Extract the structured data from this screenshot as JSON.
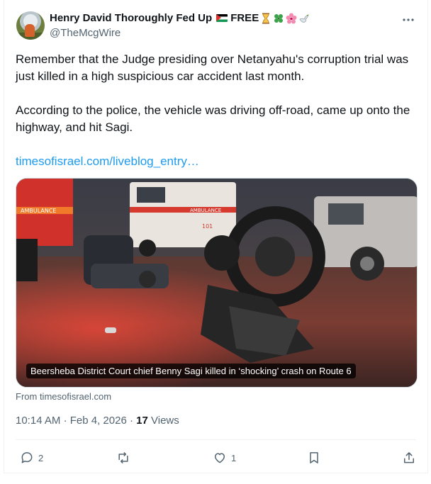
{
  "author": {
    "display_name": "Henry David Thoroughly Fed Up",
    "name_suffix": "FREE",
    "handle": "@TheMcgWire",
    "emoji_after_name": [
      "hourglass",
      "four-leaf-clover",
      "hibiscus",
      "dove"
    ]
  },
  "tweet": {
    "paragraph_1": "Remember that the Judge presiding over Netanyahu's corruption trial was just killed in a high suspicious car accident last month.",
    "paragraph_2": "According to the police, the vehicle was driving off-road, came up onto the highway, and hit Sagi.",
    "link_text": "timesofisrael.com/liveblog_entry…"
  },
  "media": {
    "caption": "Beersheba District Court chief Benny Sagi killed in ‘shocking’ crash on Route 6",
    "source": "From timesofisrael.com",
    "vehicle_text": [
      "AMBULANCE",
      "AMBULANCE",
      "101"
    ]
  },
  "meta": {
    "time": "10:14 AM",
    "separator": "·",
    "date": "Feb 4, 2026",
    "views_count": "17",
    "views_label": "Views"
  },
  "actions": {
    "replies": "2",
    "reposts": "",
    "likes": "1"
  },
  "colors": {
    "text": "#0f1419",
    "secondary": "#536471",
    "link": "#1d9bf0",
    "border": "#eff3f4"
  }
}
